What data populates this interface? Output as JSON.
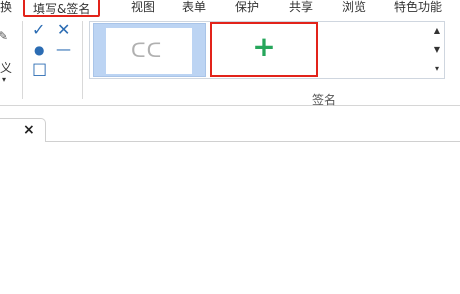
{
  "menubar": {
    "tabs": [
      {
        "label": "换",
        "active": false
      },
      {
        "label": "填写&签名",
        "active": true
      },
      {
        "label": "视图",
        "active": false
      },
      {
        "label": "表单",
        "active": false
      },
      {
        "label": "保护",
        "active": false
      },
      {
        "label": "共享",
        "active": false
      },
      {
        "label": "浏览",
        "active": false
      },
      {
        "label": "特色功能",
        "active": false
      }
    ]
  },
  "ribbon": {
    "partial_group_text": "义",
    "tools": {
      "check": "✓",
      "cross": "✕",
      "dot": "●",
      "line": "—",
      "box": "☐"
    },
    "signature_group": {
      "label": "签名",
      "saved_signature_text": "ᑕᑕ",
      "add_symbol": "+"
    }
  },
  "tabbar": {
    "close_symbol": "×"
  },
  "colors": {
    "accent_red": "#e2231a",
    "add_green": "#26a65b",
    "selected_blue": "#bcd4f3"
  }
}
